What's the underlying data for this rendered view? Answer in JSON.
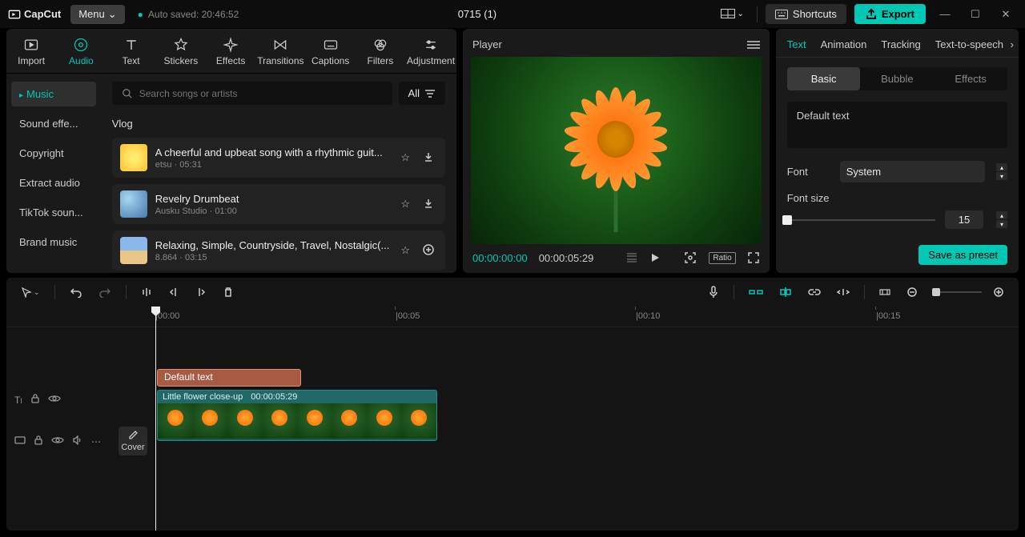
{
  "titlebar": {
    "logo": "CapCut",
    "menu": "Menu",
    "autosave": "Auto saved: 20:46:52",
    "project_title": "0715 (1)",
    "shortcuts": "Shortcuts",
    "export": "Export"
  },
  "media_tabs": {
    "import": "Import",
    "audio": "Audio",
    "text": "Text",
    "stickers": "Stickers",
    "effects": "Effects",
    "transitions": "Transitions",
    "captions": "Captions",
    "filters": "Filters",
    "adjustment": "Adjustment"
  },
  "media_sidebar": {
    "music": "Music",
    "sound_effects": "Sound effe...",
    "copyright": "Copyright",
    "extract": "Extract audio",
    "tiktok": "TikTok soun...",
    "brand": "Brand music"
  },
  "search": {
    "placeholder": "Search songs or artists",
    "all": "All"
  },
  "category": "Vlog",
  "tracks": [
    {
      "title": "A cheerful and upbeat song with a rhythmic guit...",
      "meta": "etsu · 05:31",
      "action2": "download"
    },
    {
      "title": "Revelry Drumbeat",
      "meta": "Ausku Studio · 01:00",
      "action2": "download"
    },
    {
      "title": "Relaxing, Simple, Countryside, Travel, Nostalgic(...",
      "meta": "8.864 · 03:15",
      "action2": "add"
    }
  ],
  "player": {
    "title": "Player",
    "time_current": "00:00:00:00",
    "time_duration": "00:00:05:29",
    "ratio": "Ratio"
  },
  "right": {
    "tabs": {
      "text": "Text",
      "animation": "Animation",
      "tracking": "Tracking",
      "tts": "Text-to-speech"
    },
    "sub": {
      "basic": "Basic",
      "bubble": "Bubble",
      "effects": "Effects"
    },
    "text_value": "Default text",
    "font_label": "Font",
    "font_value": "System",
    "size_label": "Font size",
    "size_value": "15",
    "save_preset": "Save as preset"
  },
  "ruler": {
    "m0": "|00:00",
    "m1": "|00:05",
    "m2": "|00:10",
    "m3": "|00:15"
  },
  "timeline": {
    "cover": "Cover",
    "text_clip": "Default text",
    "video_title": "Little flower close-up",
    "video_dur": "00:00:05:29"
  }
}
